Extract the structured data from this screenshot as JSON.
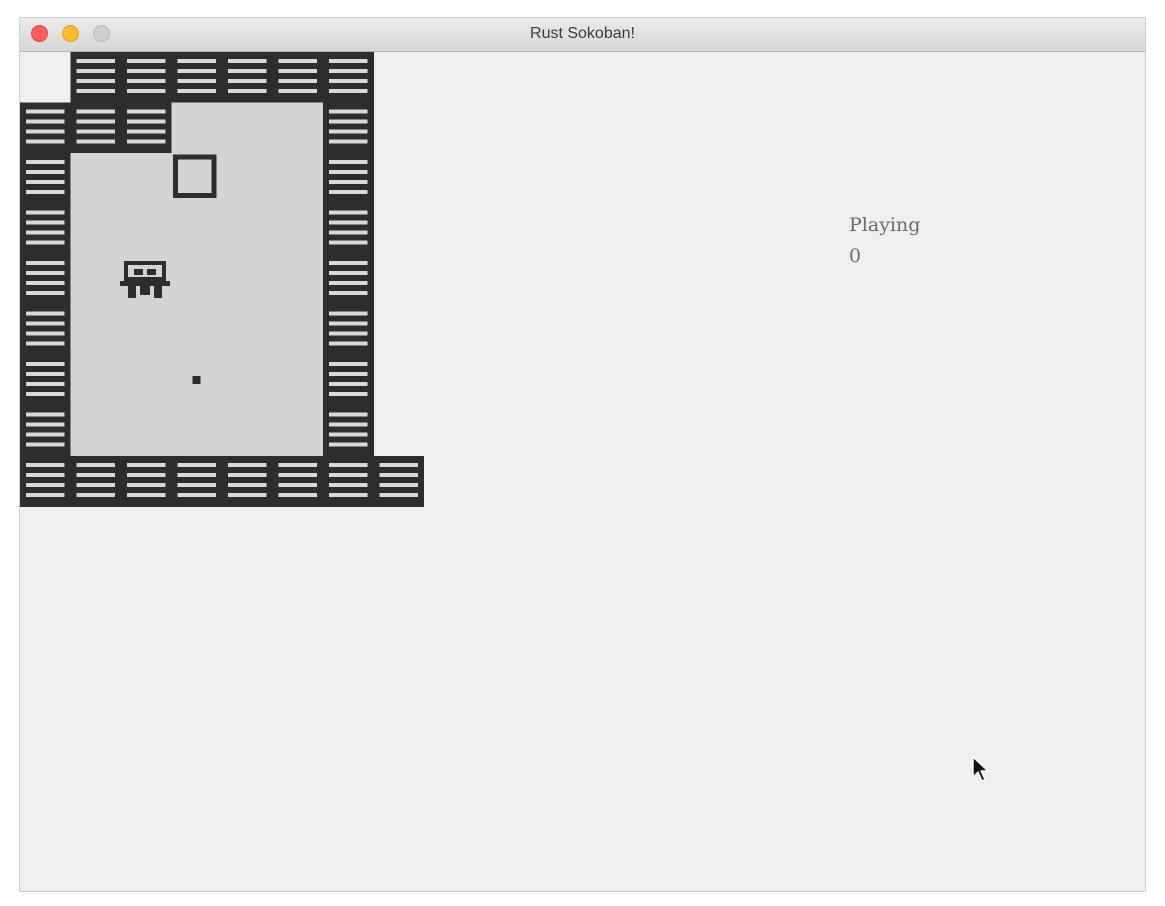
{
  "window": {
    "title": "Rust Sokoban!"
  },
  "game": {
    "state": "Playing",
    "steps": "0",
    "colors": {
      "background": "#efefef",
      "wall": "#2d2d2d",
      "wall_stripe": "#d9d9d9",
      "floor": "#d4d4d4",
      "box": "#2d2d2d",
      "player": "#2d2d2d",
      "spot": "#2d2d2d"
    },
    "map": [
      "N W W W W W W",
      "W W W . . . W",
      "W . . B . . W",
      "W . . . . . W",
      "W . P . . . W",
      "W . . . . . W",
      "W . . S . . W",
      "W . . . . . W",
      "W W W W W W W W"
    ]
  }
}
